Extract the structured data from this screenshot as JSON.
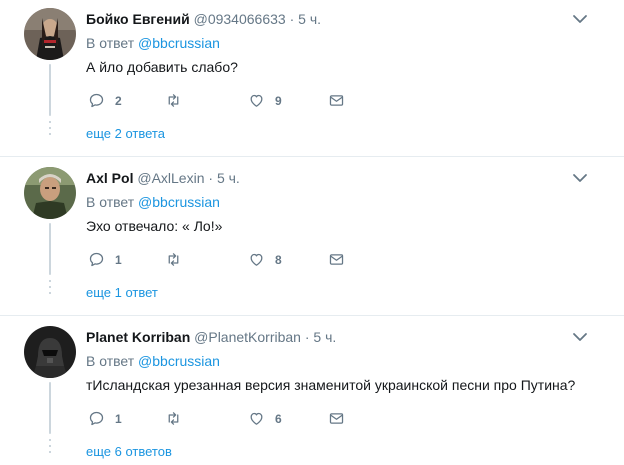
{
  "tweets": [
    {
      "name": "Бойко Евгений",
      "handle": "@0934066633",
      "separator": "·",
      "time": "5 ч.",
      "reply_prefix": "В ответ",
      "reply_mention": "@bbcrussian",
      "text": "А йло добавить слабо?",
      "replies": "2",
      "retweets": "",
      "likes": "9",
      "more_replies": "еще 2 ответа"
    },
    {
      "name": "Axl Pol",
      "handle": "@AxlLexin",
      "separator": "·",
      "time": "5 ч.",
      "reply_prefix": "В ответ",
      "reply_mention": "@bbcrussian",
      "text": "Эхо отвечало: « Ло!»",
      "replies": "1",
      "retweets": "",
      "likes": "8",
      "more_replies": "еще 1 ответ"
    },
    {
      "name": "Planet Korriban",
      "handle": "@PlanetKorriban",
      "separator": "·",
      "time": "5 ч.",
      "reply_prefix": "В ответ",
      "reply_mention": "@bbcrussian",
      "text": "тИсландская урезанная версия знаменитой украинской песни про Путина?",
      "replies": "1",
      "retweets": "",
      "likes": "6",
      "more_replies": "еще 6 ответов"
    }
  ],
  "icons": {
    "reply": "reply-icon",
    "retweet": "retweet-icon",
    "like": "heart-icon",
    "dm": "envelope-icon",
    "menu": "chevron-down-icon"
  },
  "colors": {
    "link": "#1b95e0",
    "muted": "#657786",
    "divider": "#e6ecf0"
  }
}
